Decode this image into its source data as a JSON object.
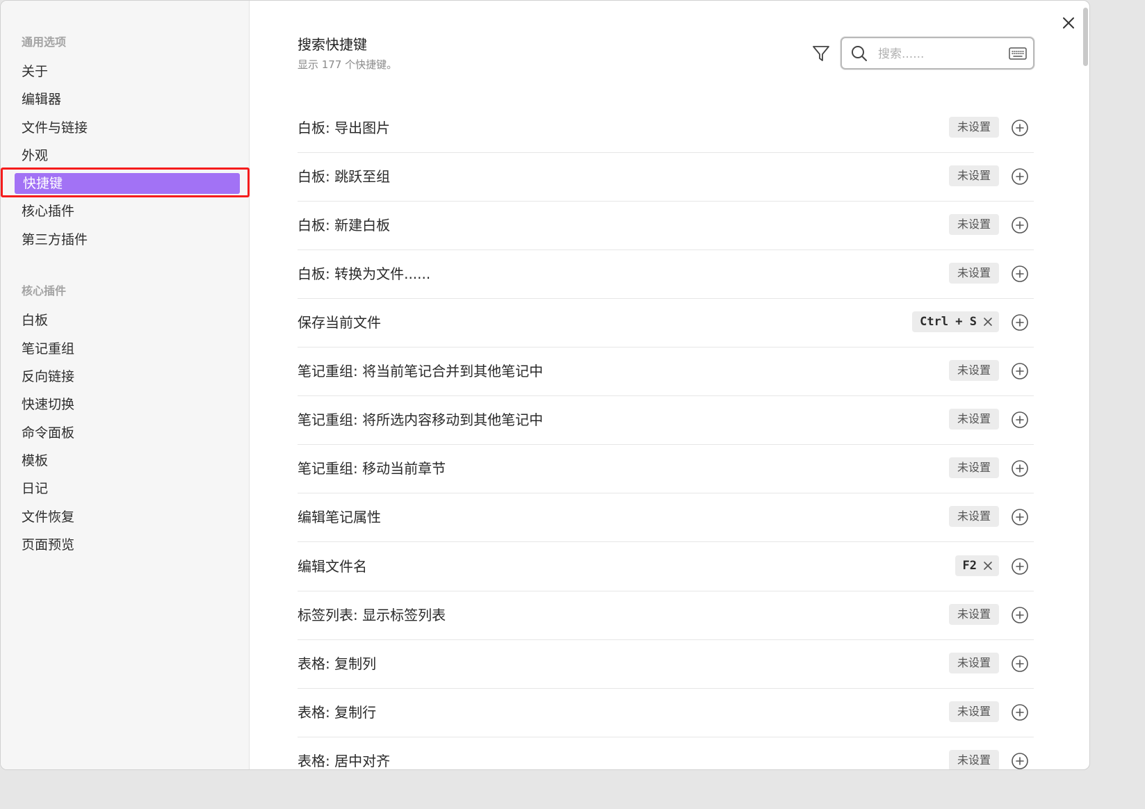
{
  "sidebar": {
    "general_heading": "通用选项",
    "general_items": [
      "关于",
      "编辑器",
      "文件与链接",
      "外观",
      "快捷键",
      "核心插件",
      "第三方插件"
    ],
    "core_heading": "核心插件",
    "core_items": [
      "白板",
      "笔记重组",
      "反向链接",
      "快速切换",
      "命令面板",
      "模板",
      "日记",
      "文件恢复",
      "页面预览"
    ],
    "active_item": "快捷键",
    "active_color": "#a272f5",
    "highlight_color": "#f51c1c"
  },
  "header": {
    "title": "搜索快捷键",
    "description": "显示 177 个快捷键。",
    "search_placeholder": "搜索......",
    "filter_icon": "filter-icon",
    "keyboard_icon": "keyboard-icon"
  },
  "hotkeys": [
    {
      "label": "白板: 导出图片",
      "status": "未设置"
    },
    {
      "label": "白板: 跳跃至组",
      "status": "未设置"
    },
    {
      "label": "白板: 新建白板",
      "status": "未设置"
    },
    {
      "label": "白板: 转换为文件......",
      "status": "未设置"
    },
    {
      "label": "保存当前文件",
      "hotkey": "Ctrl + S"
    },
    {
      "label": "笔记重组: 将当前笔记合并到其他笔记中",
      "status": "未设置"
    },
    {
      "label": "笔记重组: 将所选内容移动到其他笔记中",
      "status": "未设置"
    },
    {
      "label": "笔记重组: 移动当前章节",
      "status": "未设置"
    },
    {
      "label": "编辑笔记属性",
      "status": "未设置"
    },
    {
      "label": "编辑文件名",
      "hotkey": "F2"
    },
    {
      "label": "标签列表: 显示标签列表",
      "status": "未设置"
    },
    {
      "label": "表格: 复制列",
      "status": "未设置"
    },
    {
      "label": "表格: 复制行",
      "status": "未设置"
    },
    {
      "label": "表格: 居中对齐",
      "status": "未设置"
    }
  ]
}
